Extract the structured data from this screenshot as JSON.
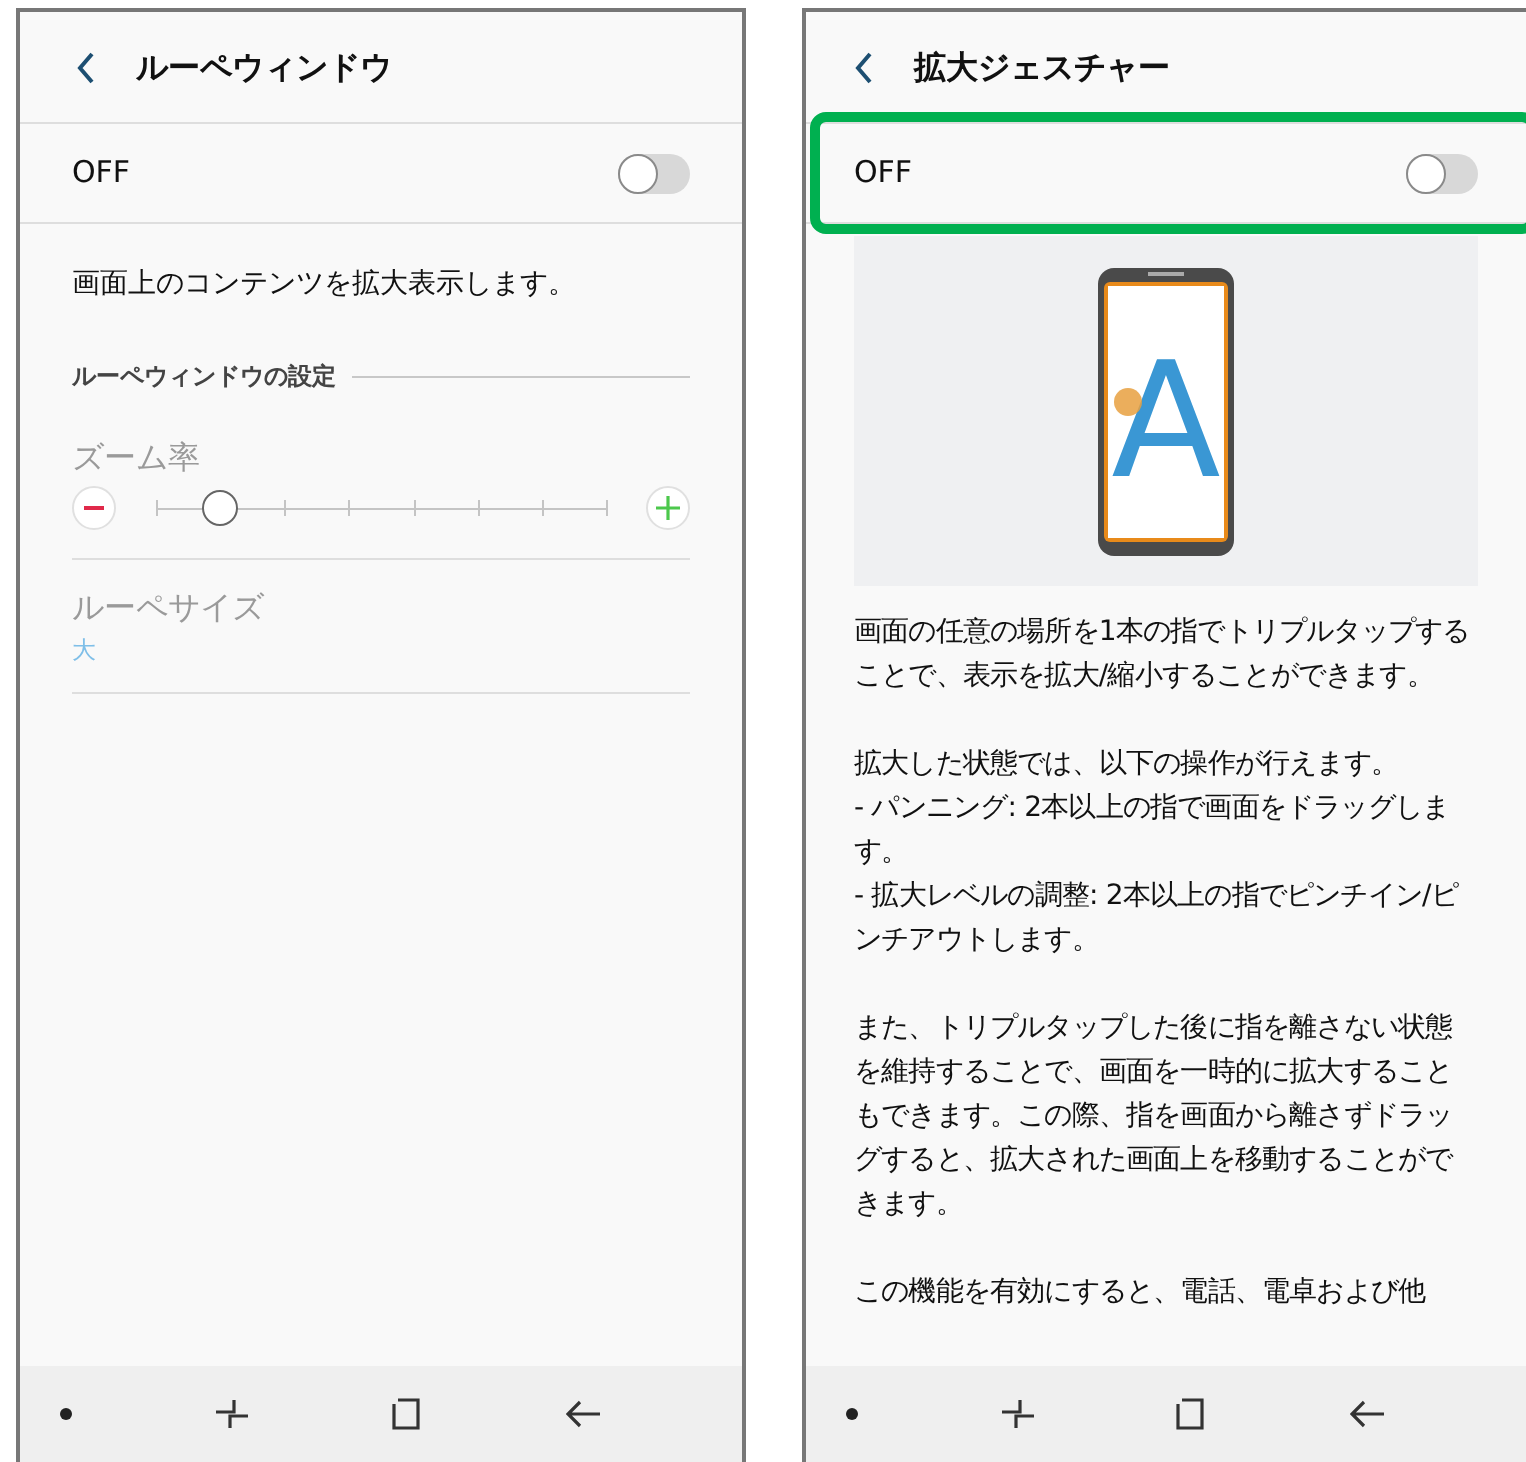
{
  "screens": [
    {
      "kind": "magnifier",
      "title": "ルーペウィンドウ",
      "toggle": {
        "label": "OFF",
        "on": false,
        "highlighted": false
      },
      "description": "画面上のコンテンツを拡大表示します。",
      "section": "ルーペウィンドウの設定",
      "zoom": {
        "label": "ズーム率",
        "level": 0.14
      },
      "size": {
        "label": "ルーペサイズ",
        "value": "大"
      }
    },
    {
      "kind": "gesture",
      "title": "拡大ジェスチャー",
      "toggle": {
        "label": "OFF",
        "on": false,
        "highlighted": true
      },
      "illustration_letter": "A",
      "paragraphs": [
        "画面の任意の場所を1本の指でトリプルタップすることで、表示を拡大/縮小することができます。",
        "拡大した状態では、以下の操作が行えます。\n- パンニング: 2本以上の指で画面をドラッグします。\n- 拡大レベルの調整: 2本以上の指でピンチイン/ピンチアウトします。",
        "また、トリプルタップした後に指を離さない状態を維持することで、画面を一時的に拡大することもできます。この際、指を画面から離さずドラッグすると、拡大された画面上を移動することができます。",
        "この機能を有効にすると、電話、電卓および他"
      ]
    }
  ]
}
